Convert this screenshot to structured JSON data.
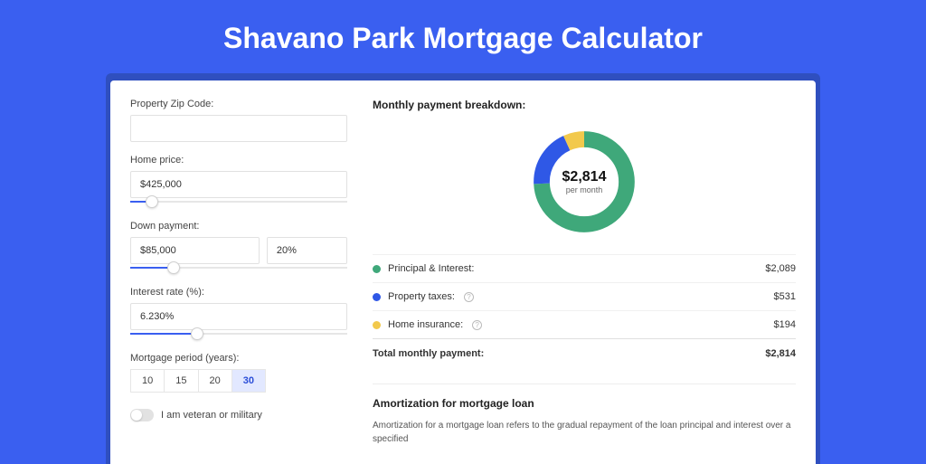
{
  "title": "Shavano Park Mortgage Calculator",
  "form": {
    "zip": {
      "label": "Property Zip Code:",
      "value": ""
    },
    "homePrice": {
      "label": "Home price:",
      "value": "$425,000",
      "sliderPct": 10
    },
    "downPayment": {
      "label": "Down payment:",
      "value": "$85,000",
      "pct": "20%",
      "sliderPct": 20
    },
    "interestRate": {
      "label": "Interest rate (%):",
      "value": "6.230%",
      "sliderPct": 31
    },
    "period": {
      "label": "Mortgage period (years):",
      "options": [
        "10",
        "15",
        "20",
        "30"
      ],
      "selected": "30"
    },
    "veteran": {
      "label": "I am veteran or military"
    }
  },
  "breakdown": {
    "title": "Monthly payment breakdown:",
    "centerValue": "$2,814",
    "centerLabel": "per month",
    "items": [
      {
        "name": "Principal & Interest:",
        "value": "$2,089",
        "color": "#3fa87a",
        "info": false
      },
      {
        "name": "Property taxes:",
        "value": "$531",
        "color": "#2f58e6",
        "info": true
      },
      {
        "name": "Home insurance:",
        "value": "$194",
        "color": "#f2c94c",
        "info": true
      }
    ],
    "totalLabel": "Total monthly payment:",
    "totalValue": "$2,814"
  },
  "amortization": {
    "title": "Amortization for mortgage loan",
    "text": "Amortization for a mortgage loan refers to the gradual repayment of the loan principal and interest over a specified"
  },
  "colors": {
    "principal": "#3fa87a",
    "taxes": "#2f58e6",
    "insurance": "#f2c94c"
  },
  "chart_data": {
    "type": "pie",
    "title": "Monthly payment breakdown",
    "categories": [
      "Principal & Interest",
      "Property taxes",
      "Home insurance"
    ],
    "values": [
      2089,
      531,
      194
    ],
    "total": 2814
  }
}
